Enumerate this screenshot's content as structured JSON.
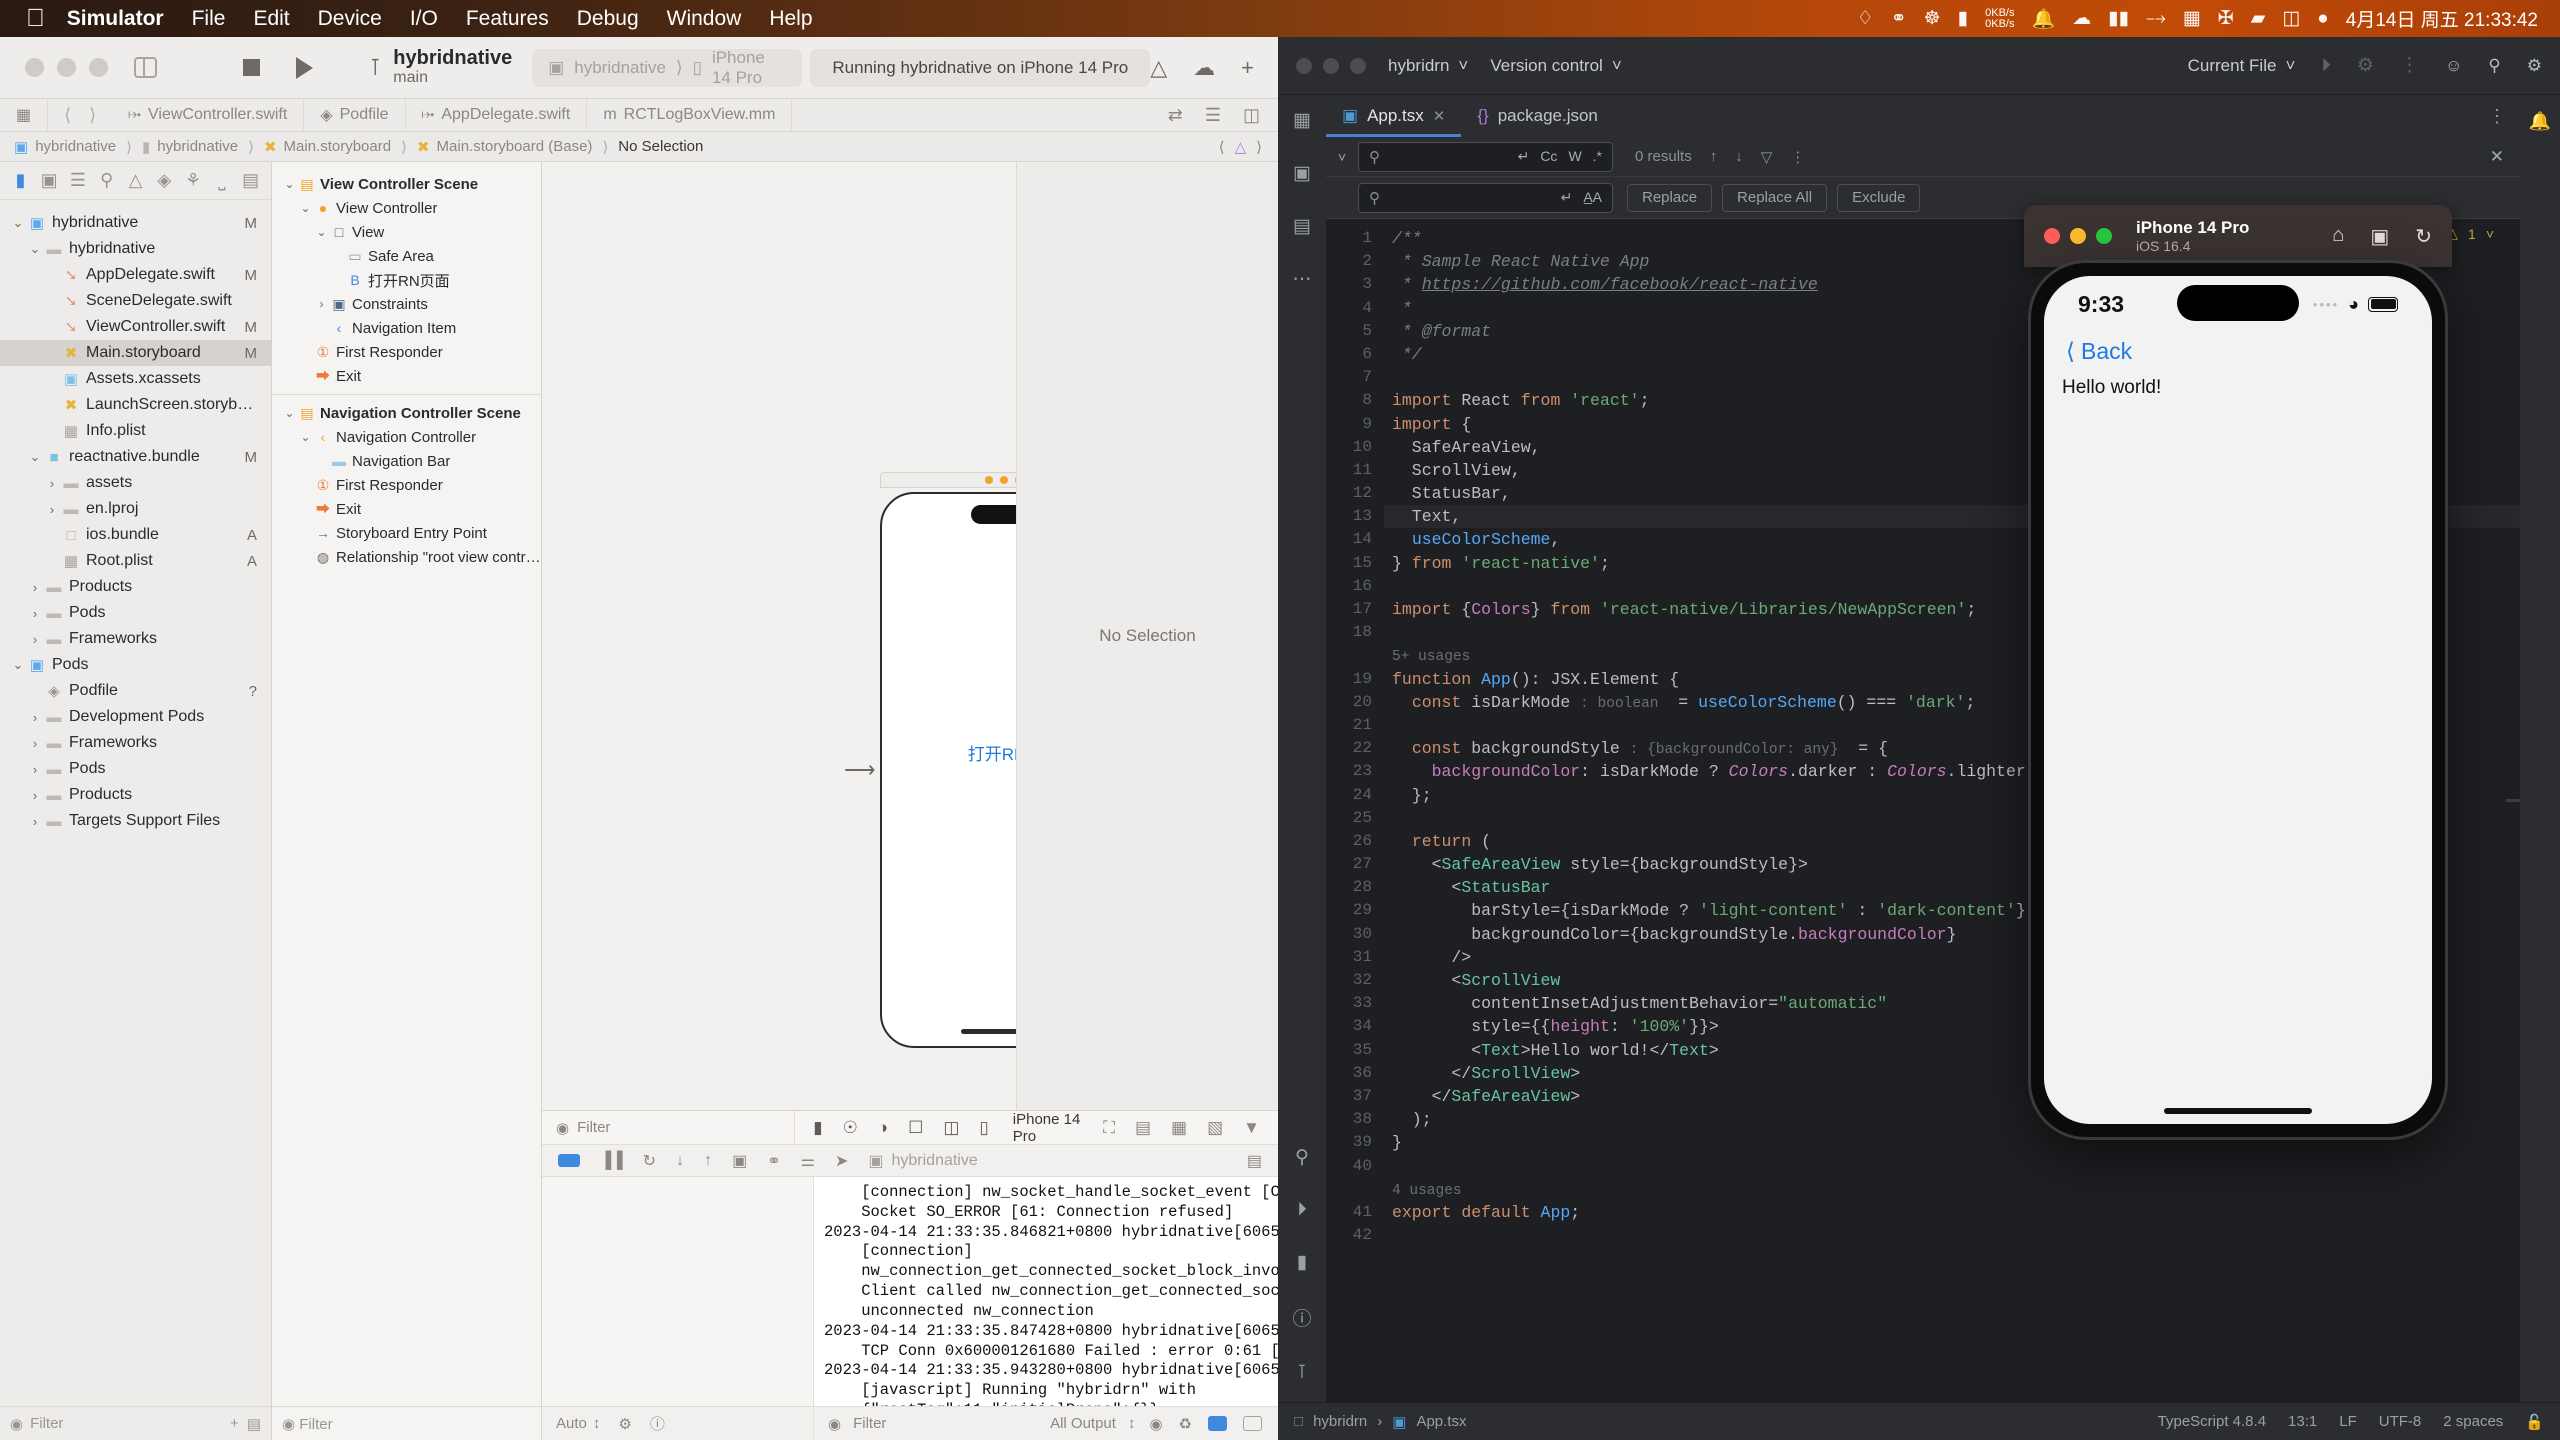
{
  "menubar": {
    "apple_icon": "apple-icon",
    "items": [
      {
        "label": "Simulator",
        "bold": true
      },
      {
        "label": "File",
        "bold": false
      },
      {
        "label": "Edit",
        "bold": false
      },
      {
        "label": "Device",
        "bold": false
      },
      {
        "label": "I/O",
        "bold": false
      },
      {
        "label": "Features",
        "bold": false
      },
      {
        "label": "Debug",
        "bold": false
      },
      {
        "label": "Window",
        "bold": false
      },
      {
        "label": "Help",
        "bold": false
      }
    ],
    "status_icons": [
      "dropbox-icon",
      "key-icon",
      "sync-icon",
      "battery-widget-icon",
      "bell-icon",
      "cloud-icon",
      "pause-icon",
      "bluetooth-off-icon",
      "keyboard-icon",
      "scissors-icon",
      "display-icon",
      "users-icon",
      "siri-icon"
    ],
    "net_up": "0KB/s",
    "net_down": "0KB/s",
    "clock": "4月14日 周五 21:33:42"
  },
  "xcode": {
    "toolbar": {
      "branch_icon": "branch-icon",
      "project": "hybridnative",
      "branch": "main",
      "destination_app": "hybridnative",
      "destination_device": "iPhone 14 Pro",
      "status": "Running hybridnative on iPhone 14 Pro",
      "right_icons": [
        "warning-icon",
        "cloud-icon",
        "add-icon"
      ]
    },
    "tabbar": {
      "items": [
        {
          "label": "ViewController.swift",
          "icon": "swift-icon"
        },
        {
          "label": "Podfile",
          "icon": "ruby-gem-icon"
        },
        {
          "label": "AppDelegate.swift",
          "icon": "swift-icon"
        },
        {
          "label": "RCTLogBoxView.mm",
          "icon": "objc-icon"
        }
      ],
      "right_icons": [
        "compare-icon",
        "lines-icon",
        "inspector-icon"
      ]
    },
    "breadcrumb": [
      "hybridnative",
      "hybridnative",
      "Main.storyboard",
      "Main.storyboard (Base)",
      "No Selection"
    ],
    "navigator": {
      "icons": [
        "folder-icon",
        "source-control-icon",
        "symbol-icon",
        "search-icon",
        "warning-icon",
        "test-icon",
        "debug-icon",
        "breakpoint-icon",
        "report-icon"
      ],
      "tree": [
        {
          "label": "hybridnative",
          "depth": 0,
          "icon": "xcode-project-icon",
          "twisty": "down",
          "mod": "M"
        },
        {
          "label": "hybridnative",
          "depth": 1,
          "icon": "folder-icon",
          "twisty": "down",
          "mod": ""
        },
        {
          "label": "AppDelegate.swift",
          "depth": 2,
          "icon": "swift-icon",
          "twisty": "",
          "mod": "M"
        },
        {
          "label": "SceneDelegate.swift",
          "depth": 2,
          "icon": "swift-icon",
          "twisty": "",
          "mod": ""
        },
        {
          "label": "ViewController.swift",
          "depth": 2,
          "icon": "swift-icon",
          "twisty": "",
          "mod": "M"
        },
        {
          "label": "Main.storyboard",
          "depth": 2,
          "icon": "storyboard-icon",
          "twisty": "",
          "mod": "M",
          "selected": true
        },
        {
          "label": "Assets.xcassets",
          "depth": 2,
          "icon": "assets-icon",
          "twisty": "",
          "mod": ""
        },
        {
          "label": "LaunchScreen.storyboard",
          "depth": 2,
          "icon": "storyboard-icon",
          "twisty": "",
          "mod": ""
        },
        {
          "label": "Info.plist",
          "depth": 2,
          "icon": "plist-icon",
          "twisty": "",
          "mod": ""
        },
        {
          "label": "reactnative.bundle",
          "depth": 1,
          "icon": "bundle-icon",
          "twisty": "down",
          "mod": "M"
        },
        {
          "label": "assets",
          "depth": 2,
          "icon": "folder-icon",
          "twisty": "right",
          "mod": ""
        },
        {
          "label": "en.lproj",
          "depth": 2,
          "icon": "folder-icon",
          "twisty": "right",
          "mod": ""
        },
        {
          "label": "ios.bundle",
          "depth": 2,
          "icon": "file-icon",
          "twisty": "",
          "mod": "A"
        },
        {
          "label": "Root.plist",
          "depth": 2,
          "icon": "plist-icon",
          "twisty": "",
          "mod": "A"
        },
        {
          "label": "Products",
          "depth": 1,
          "icon": "folder-icon",
          "twisty": "right",
          "mod": ""
        },
        {
          "label": "Pods",
          "depth": 1,
          "icon": "folder-icon",
          "twisty": "right",
          "mod": ""
        },
        {
          "label": "Frameworks",
          "depth": 1,
          "icon": "folder-icon",
          "twisty": "right",
          "mod": ""
        },
        {
          "label": "Pods",
          "depth": 0,
          "icon": "xcode-project-icon",
          "twisty": "down",
          "mod": ""
        },
        {
          "label": "Podfile",
          "depth": 1,
          "icon": "ruby-gem-icon",
          "twisty": "",
          "mod": "?"
        },
        {
          "label": "Development Pods",
          "depth": 1,
          "icon": "folder-icon",
          "twisty": "right",
          "mod": ""
        },
        {
          "label": "Frameworks",
          "depth": 1,
          "icon": "folder-icon",
          "twisty": "right",
          "mod": ""
        },
        {
          "label": "Pods",
          "depth": 1,
          "icon": "folder-icon",
          "twisty": "right",
          "mod": ""
        },
        {
          "label": "Products",
          "depth": 1,
          "icon": "folder-icon",
          "twisty": "right",
          "mod": ""
        },
        {
          "label": "Targets Support Files",
          "depth": 1,
          "icon": "folder-icon",
          "twisty": "right",
          "mod": ""
        }
      ],
      "filter_placeholder": "Filter"
    },
    "outline": {
      "rows": [
        {
          "label": "View Controller Scene",
          "depth": 0,
          "icon": "scene-icon",
          "twisty": "down",
          "bold": true
        },
        {
          "label": "View Controller",
          "depth": 1,
          "icon": "viewcontroller-icon",
          "twisty": "down",
          "bold": false
        },
        {
          "label": "View",
          "depth": 2,
          "icon": "view-icon",
          "twisty": "down",
          "bold": false
        },
        {
          "label": "Safe Area",
          "depth": 3,
          "icon": "safearea-icon",
          "twisty": "",
          "bold": false
        },
        {
          "label": "打开RN页面",
          "depth": 3,
          "icon": "button-icon",
          "twisty": "",
          "bold": false
        },
        {
          "label": "Constraints",
          "depth": 2,
          "icon": "constraints-icon",
          "twisty": "right",
          "bold": false
        },
        {
          "label": "Navigation Item",
          "depth": 2,
          "icon": "navitem-icon",
          "twisty": "",
          "bold": false
        },
        {
          "label": "First Responder",
          "depth": 1,
          "icon": "first-responder-icon",
          "twisty": "",
          "bold": false
        },
        {
          "label": "Exit",
          "depth": 1,
          "icon": "exit-icon",
          "twisty": "",
          "bold": false
        },
        {
          "separator": true
        },
        {
          "label": "Navigation Controller Scene",
          "depth": 0,
          "icon": "scene-icon",
          "twisty": "down",
          "bold": true
        },
        {
          "label": "Navigation Controller",
          "depth": 1,
          "icon": "navcontroller-icon",
          "twisty": "down",
          "bold": false
        },
        {
          "label": "Navigation Bar",
          "depth": 2,
          "icon": "navbar-icon",
          "twisty": "",
          "bold": false
        },
        {
          "label": "First Responder",
          "depth": 1,
          "icon": "first-responder-icon",
          "twisty": "",
          "bold": false
        },
        {
          "label": "Exit",
          "depth": 1,
          "icon": "exit-icon",
          "twisty": "",
          "bold": false
        },
        {
          "label": "Storyboard Entry Point",
          "depth": 1,
          "icon": "entry-point-icon",
          "twisty": "",
          "bold": false
        },
        {
          "label": "Relationship \"root view contro...",
          "depth": 1,
          "icon": "relationship-icon",
          "twisty": "",
          "bold": false
        }
      ],
      "filter_placeholder": "Filter"
    },
    "canvas": {
      "rn_button_label": "打开RN页面",
      "mini_label": "打开RN页面",
      "no_selection": "No Selection"
    },
    "debug": {
      "filter_placeholder": "Filter",
      "device": "iPhone 14 Pro",
      "process": "hybridnative",
      "console": "    [connection] nw_socket_handle_socket_event [C8.1.2:1]\n    Socket SO_ERROR [61: Connection refused]\n2023-04-14 21:33:35.846821+0800 hybridnative[60655:1484396]\n    [connection]\n    nw_connection_get_connected_socket_block_invoke [C8]\n    Client called nw_connection_get_connected_socket on\n    unconnected nw_connection\n2023-04-14 21:33:35.847428+0800 hybridnative[60655:1484396]\n    TCP Conn 0x600001261680 Failed : error 0:61 [61]\n2023-04-14 21:33:35.943280+0800 hybridnative[60655:1491376]\n    [javascript] Running \"hybridrn\" with\n    {\"rootTag\":11,\"initialProps\":{}}\nOptional(nil)\nOptional(nil)",
      "auto_label": "Auto",
      "bottom_filter_placeholder": "Filter",
      "output_label": "All Output"
    }
  },
  "ide": {
    "titlebar": {
      "project": "hybridrn",
      "vcs": "Version control",
      "run_config": "Current File",
      "icons": [
        "run-icon",
        "debug-icon",
        "more-icon",
        "add-user-icon",
        "search-icon",
        "settings-icon"
      ]
    },
    "tabs": [
      {
        "label": "App.tsx",
        "icon": "tsx-file-icon",
        "active": true
      },
      {
        "label": "package.json",
        "icon": "json-file-icon",
        "active": false
      }
    ],
    "find": {
      "query_placeholder": "",
      "results": "0 results",
      "icons": [
        "regex-icon",
        "match-case-icon",
        "words-icon",
        "regex-star-icon",
        "up-icon",
        "down-icon",
        "filter-icon",
        "more-icon",
        "close-icon"
      ]
    },
    "replace": {
      "buttons": [
        "Replace",
        "Replace All",
        "Exclude"
      ]
    },
    "editor": {
      "warning_count": "1",
      "lines": [
        {
          "n": 1,
          "html": "<span class=\"cmt\">/**</span>"
        },
        {
          "n": 2,
          "html": "<span class=\"cmt\"> * Sample React Native App</span>"
        },
        {
          "n": 3,
          "html": "<span class=\"cmt\"> * </span><span class=\"lnk\">https://github.com/facebook/react-native</span>"
        },
        {
          "n": 4,
          "html": "<span class=\"cmt\"> *</span>"
        },
        {
          "n": 5,
          "html": "<span class=\"cmt\"> * @format</span>"
        },
        {
          "n": 6,
          "html": "<span class=\"cmt\"> */</span>"
        },
        {
          "n": 7,
          "html": ""
        },
        {
          "n": 8,
          "html": "<span class=\"kw\">import</span> React <span class=\"kw\">from</span> <span class=\"str\">'react'</span>;"
        },
        {
          "n": 9,
          "html": "<span class=\"kw\">import</span> {"
        },
        {
          "n": 10,
          "html": "  SafeAreaView,"
        },
        {
          "n": 11,
          "html": "  ScrollView,"
        },
        {
          "n": 12,
          "html": "  StatusBar,",
          "bulb": true
        },
        {
          "n": 13,
          "html": "  Text,",
          "current": true
        },
        {
          "n": 14,
          "html": "  <span class=\"fn\">useColorScheme</span>,"
        },
        {
          "n": 15,
          "html": "} <span class=\"kw\">from</span> <span class=\"str\">'react-native'</span>;"
        },
        {
          "n": 16,
          "html": ""
        },
        {
          "n": 17,
          "html": "<span class=\"kw\">import</span> {<span class=\"prop\">Colors</span>} <span class=\"kw\">from</span> <span class=\"str\">'react-native/Libraries/NewAppScreen'</span>;"
        },
        {
          "n": 18,
          "html": ""
        },
        {
          "n": null,
          "html": "<span class=\"hint\">5+ usages</span>",
          "hintrow": true
        },
        {
          "n": 19,
          "html": "<span class=\"kw\">function</span> <span class=\"fn\">App</span>(): JSX.Element {"
        },
        {
          "n": 20,
          "html": "  <span class=\"kw\">const</span> isDarkMode <span class=\"hint\">: boolean</span>  = <span class=\"fn\">useColorScheme</span>() === <span class=\"str\">'dark'</span>;"
        },
        {
          "n": 21,
          "html": ""
        },
        {
          "n": 22,
          "html": "  <span class=\"kw\">const</span> backgroundStyle <span class=\"hint\">: {backgroundColor: any}</span>  = {"
        },
        {
          "n": 23,
          "html": "    <span class=\"prop\">backgroundColor</span>: isDarkMode ? <span class=\"typ\" style=\"color:#c77dbb;font-style:italic\">Colors</span>.darker : <span class=\"typ\" style=\"color:#c77dbb;font-style:italic\">Colors</span>.lighter,"
        },
        {
          "n": 24,
          "html": "  };"
        },
        {
          "n": 25,
          "html": ""
        },
        {
          "n": 26,
          "html": "  <span class=\"kw\">return</span> ("
        },
        {
          "n": 27,
          "html": "    &lt;<span class=\"tag\">SafeAreaView</span> style={backgroundStyle}&gt;"
        },
        {
          "n": 28,
          "html": "      &lt;<span class=\"tag\">StatusBar</span>"
        },
        {
          "n": 29,
          "html": "        barStyle={isDarkMode ? <span class=\"str\">'light-content'</span> : <span class=\"str\">'dark-content'</span>}"
        },
        {
          "n": 30,
          "html": "        backgroundColor={backgroundStyle.<span class=\"prop\">backgroundColor</span>}"
        },
        {
          "n": 31,
          "html": "      /&gt;"
        },
        {
          "n": 32,
          "html": "      &lt;<span class=\"tag\">ScrollView</span>"
        },
        {
          "n": 33,
          "html": "        contentInsetAdjustmentBehavior=<span class=\"str\">\"automatic\"</span>"
        },
        {
          "n": 34,
          "html": "        style={{<span class=\"prop\">height</span>: <span class=\"str\">'100%'</span>}}&gt;"
        },
        {
          "n": 35,
          "html": "        &lt;<span class=\"tag\">Text</span>&gt;Hello world!&lt;/<span class=\"tag\">Text</span>&gt;"
        },
        {
          "n": 36,
          "html": "      &lt;/<span class=\"tag\">ScrollView</span>&gt;"
        },
        {
          "n": 37,
          "html": "    &lt;/<span class=\"tag\">SafeAreaView</span>&gt;"
        },
        {
          "n": 38,
          "html": "  );"
        },
        {
          "n": 39,
          "html": "}"
        },
        {
          "n": 40,
          "html": ""
        },
        {
          "n": null,
          "html": "<span class=\"hint\">4 usages</span>",
          "hintrow": true
        },
        {
          "n": 41,
          "html": "<span class=\"kw\">export</span> <span class=\"kw\">default</span> <span class=\"fn\">App</span>;"
        },
        {
          "n": 42,
          "html": ""
        }
      ]
    },
    "statusbar": {
      "breadcrumb": [
        "hybridrn",
        "App.tsx"
      ],
      "language": "TypeScript 4.8.4",
      "caret": "13:1",
      "line_sep": "LF",
      "encoding": "UTF-8",
      "indent": "2 spaces",
      "lock_icon": "lock-icon"
    },
    "left_rail_icons": [
      "project-icon",
      "commit-icon",
      "structure-icon",
      "more-icon",
      "search-everywhere-icon",
      "run-tool-icon",
      "terminal-icon",
      "problems-icon",
      "git-icon"
    ],
    "right_rail_icons": [
      "notifications-icon",
      "ai-icon",
      "database-icon",
      "gradle-icon"
    ]
  },
  "simulator": {
    "device": "iPhone 14 Pro",
    "os": "iOS 16.4",
    "actions": [
      "home-icon",
      "screenshot-icon",
      "rotate-icon"
    ],
    "traffic_colors": {
      "close": "#ff5f57",
      "min": "#febc2e",
      "max": "#28c840"
    },
    "screen": {
      "time": "9:33",
      "wifi_icon": "wifi-icon",
      "battery_icon": "battery-icon",
      "back_label": "Back",
      "body_text": "Hello world!"
    }
  },
  "colors": {
    "accent_blue": "#1f7ae0",
    "ide_bg": "#1e1f22",
    "ide_panel": "#2b2d30",
    "xcode_bg": "#eeecea",
    "menubar_orange": "#c24a07"
  }
}
